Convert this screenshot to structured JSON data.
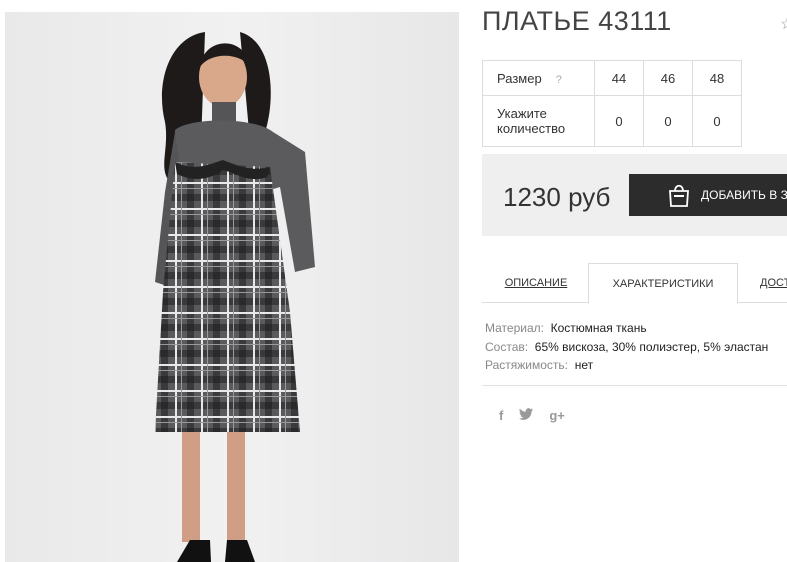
{
  "product": {
    "title": "ПЛАТЬЕ 43111"
  },
  "sizes": {
    "size_label": "Размер",
    "help": "?",
    "values": [
      "44",
      "46",
      "48"
    ],
    "qty_label": "Укажите количество",
    "quantities": [
      "0",
      "0",
      "0"
    ]
  },
  "purchase": {
    "price": "1230 руб",
    "cart_label": "ДОБАВИТЬ В ЗА"
  },
  "tabs": {
    "description": "ОПИСАНИЕ",
    "characteristics": "ХАРАКТЕРИСТИКИ",
    "delivery": "ДОСТ"
  },
  "props": {
    "material_key": "Материал:",
    "material_val": "Костюмная ткань",
    "composition_key": "Состав:",
    "composition_val": "65% вискоза, 30% полиэстер, 5% эластан",
    "stretch_key": "Растяжимость:",
    "stretch_val": "нет"
  },
  "social": {
    "facebook": "f",
    "twitter_icon": "twitter-icon",
    "googleplus": "g+"
  },
  "colors": {
    "button_bg": "#2c2c2c",
    "buy_panel_bg": "#efefef"
  }
}
